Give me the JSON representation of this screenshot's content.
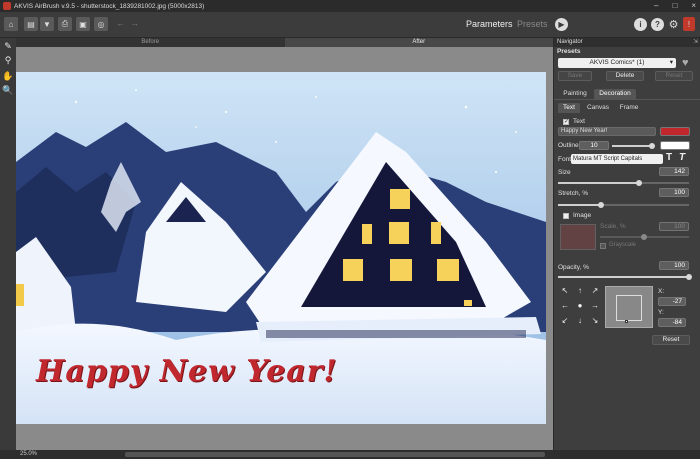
{
  "window": {
    "title": "AKVIS AirBrush v.9.5 - shutterstock_1839281002.jpg (5000x2813)",
    "controls": [
      "–",
      "□",
      "×"
    ]
  },
  "toolbar": {
    "mode_tabs": [
      "Parameters",
      "Presets"
    ],
    "icons": [
      "home-icon",
      "open-file-icon",
      "save-icon",
      "print-icon",
      "batch-icon",
      "share-icon",
      "undo-icon",
      "redo-icon",
      "play-icon",
      "info-icon",
      "help-icon",
      "settings-icon",
      "notifications-icon"
    ]
  },
  "view_tabs": {
    "before": "Before",
    "after": "After"
  },
  "canvas": {
    "greeting": "Happy New Year!"
  },
  "status": {
    "zoom": "25.0%"
  },
  "panel": {
    "header": "Navigator",
    "presets_label": "Presets",
    "preset_selected": "AKVIS Comics* (1)",
    "preset_buttons": {
      "save": "Save",
      "delete": "Delete",
      "reset": "Reset"
    },
    "main_tabs": [
      "Painting",
      "Decoration"
    ],
    "sub_tabs": [
      "Text",
      "Canvas",
      "Frame"
    ],
    "text": {
      "checkbox_label": "Text",
      "value": "Happy New Year!",
      "color": "#c0282e",
      "outline_label": "Outline",
      "outline_value": "10",
      "outline_color": "#ffffff",
      "font_label": "Font",
      "font_value": "Matura MT Script Capitals",
      "size_label": "Size",
      "size_value": "142",
      "size_level": 0.62,
      "stretch_label": "Stretch, %",
      "stretch_value": "100",
      "stretch_level": 0.33
    },
    "image": {
      "checkbox_label": "Image",
      "scale_label": "Scale, %",
      "scale_value": "100",
      "grayscale_label": "Grayscale",
      "opacity_label": "Opacity, %",
      "opacity_value": "100"
    },
    "position": {
      "x_label": "X:",
      "x_value": "-27",
      "y_label": "Y:",
      "y_value": "-84",
      "reset_label": "Reset"
    }
  }
}
